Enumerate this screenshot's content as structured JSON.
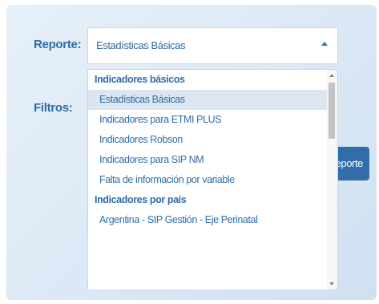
{
  "form": {
    "report_label": "Reporte:",
    "filters_label": "Filtros:",
    "report_select": {
      "value": "Estadísticas Básicas"
    },
    "report_button_label": "eporte"
  },
  "dropdown": {
    "groups": [
      {
        "header": "Indicadores básicos",
        "options": [
          "Estadísticas Básicas",
          "Indicadores para ETMI PLUS",
          "Indicadores Robson",
          "Indicadores para SIP NM",
          "Falta de información por variable"
        ]
      },
      {
        "header": "Indicadores por país",
        "options": [
          "Argentina - SIP Gestión - Eje Perinatal"
        ]
      }
    ],
    "selected_option": "Estadísticas Básicas"
  }
}
